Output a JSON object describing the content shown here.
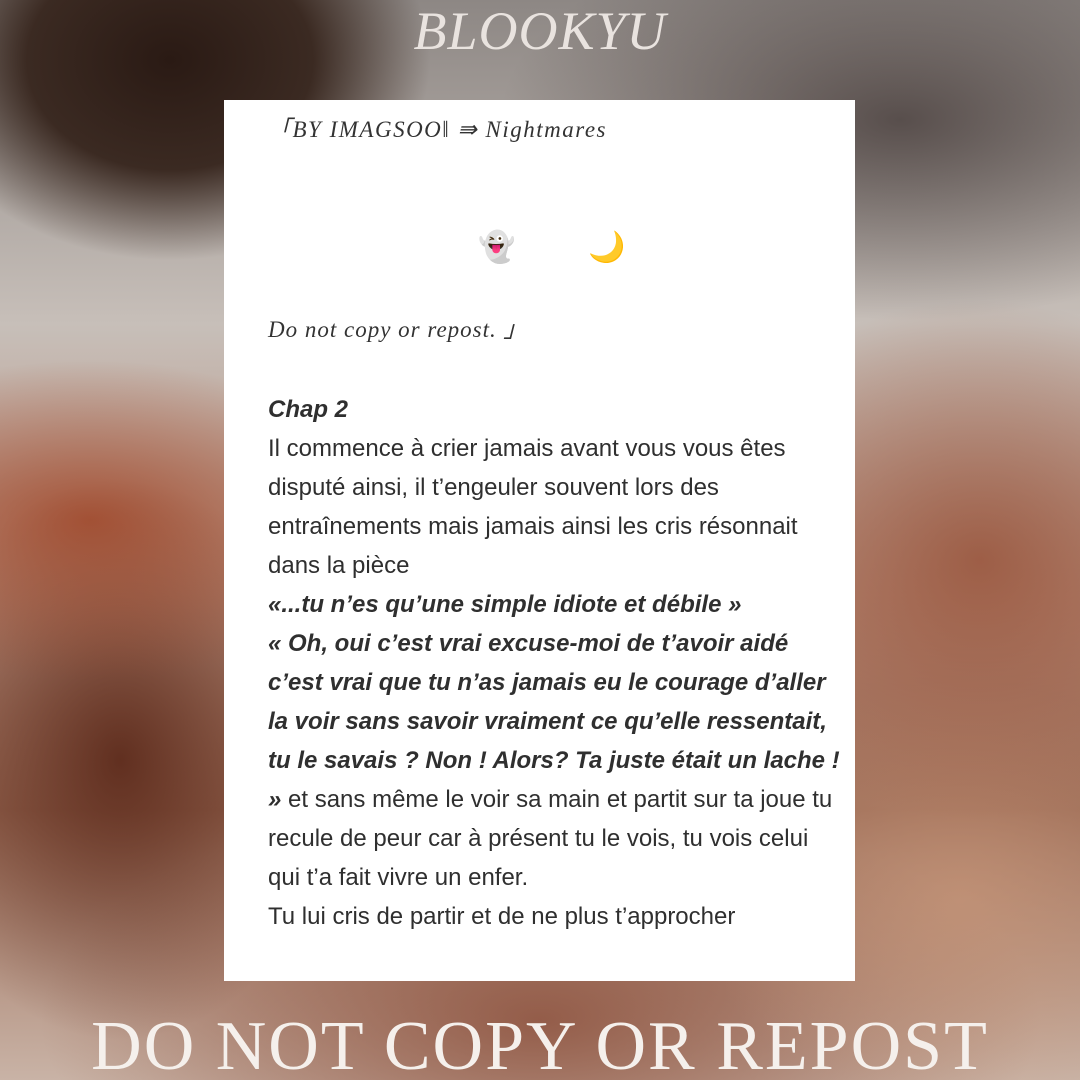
{
  "brand": "BLOOKYU",
  "card": {
    "header": "「BY IMAGSOO‖ ⇛ Nightmares",
    "icons": {
      "ghost": "👻",
      "moon": "🌙"
    },
    "notice": "Do not copy or repost. 」",
    "chapter": "Chap 2",
    "paragraph1": "Il commence à crier jamais avant vous vous êtes disputé ainsi, il t’engeuler souvent lors des entraînements mais jamais ainsi les cris résonnait dans la pièce",
    "quote1": "«...tu n’es qu’une simple idiote et débile »",
    "quote2": "« Oh, oui c’est vrai  excuse-moi de t’avoir aidé c’est vrai que tu n’as jamais eu le courage d’aller la voir sans savoir vraiment ce qu’elle ressentait, tu le savais ? Non ! Alors? Ta juste était un lache ! »",
    "continuation": " et sans même le voir sa main et partit sur ta joue tu recule de peur car à présent tu le vois, tu vois celui qui t’a fait vivre un enfer.",
    "last_line": "Tu lui cris de partir et de ne plus t’approcher"
  },
  "watermark": "DO NOT COPY OR REPOST"
}
